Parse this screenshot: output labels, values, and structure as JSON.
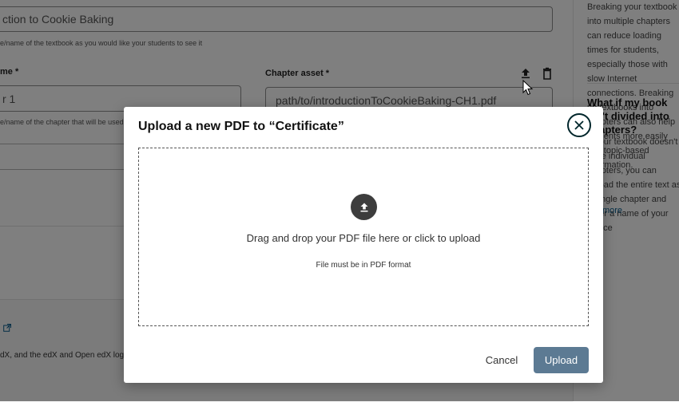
{
  "background": {
    "textbook_name_value": "ction to Cookie Baking",
    "textbook_name_help": "e/name of the textbook as you would like your students to see it",
    "chapter_name_label": "me *",
    "chapter_name_value": "r 1",
    "chapter_name_help": "e/name of the chapter that will be used",
    "chapter_asset_label": "Chapter asset *",
    "chapter_asset_value": "path/to/introductionToCookieBaking-CH1.pdf",
    "footer_text": "dX, and the edX and Open edX log",
    "upload_icon": "upload-icon",
    "delete_icon": "trash-icon",
    "external_link_icon": "external-link-icon"
  },
  "sidebar": {
    "text1": "Breaking your textbook into multiple chapters can reduce loading times for students, especially those with slow Internet connections. Breaking up textbooks into chapters can also help students more easily find topic-based information.",
    "heading": "What if my book isn't divided into chapters?",
    "text2": "If your textbook doesn't have individual chapters, you can upload the entire text as a single chapter and enter a name of your choice",
    "link": "arn more"
  },
  "modal": {
    "title": "Upload a new PDF to “Certificate”",
    "close_icon": "close-icon",
    "dropzone_icon": "upload-icon",
    "dropzone_text": "Drag and drop your PDF file here or click to upload",
    "dropzone_hint": "File must be in PDF format",
    "cancel_label": "Cancel",
    "upload_label": "Upload"
  },
  "colors": {
    "overlay": "#000000",
    "upload_button": "#5c7a93",
    "close_border": "#00262b",
    "link": "#0a5e8e"
  }
}
